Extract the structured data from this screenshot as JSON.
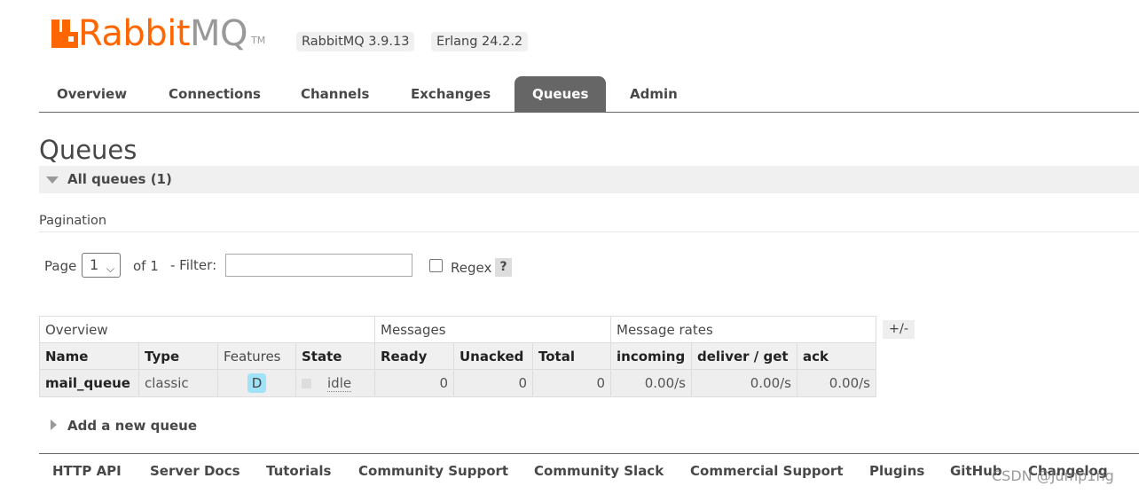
{
  "header": {
    "logo_rabbit": "Rabbit",
    "logo_mq": "MQ",
    "logo_tm": "TM",
    "rabbitmq_version": "RabbitMQ 3.9.13",
    "erlang_version": "Erlang 24.2.2"
  },
  "tabs": [
    "Overview",
    "Connections",
    "Channels",
    "Exchanges",
    "Queues",
    "Admin"
  ],
  "active_tab": "Queues",
  "page": {
    "title": "Queues",
    "section": "All queues (1)",
    "pagination_title": "Pagination",
    "page_label": "Page",
    "page_value": "1",
    "of_label": "of 1",
    "filter_label": "- Filter:",
    "filter_value": "",
    "regex_label": "Regex",
    "regex_checked": false,
    "help_label": "?"
  },
  "table": {
    "groups": [
      "Overview",
      "Messages",
      "Message rates"
    ],
    "columns": [
      "Name",
      "Type",
      "Features",
      "State",
      "Ready",
      "Unacked",
      "Total",
      "incoming",
      "deliver / get",
      "ack"
    ],
    "rows": [
      {
        "name": "mail_queue",
        "type": "classic",
        "features": "D",
        "state": "idle",
        "ready": "0",
        "unacked": "0",
        "total": "0",
        "incoming": "0.00/s",
        "deliver_get": "0.00/s",
        "ack": "0.00/s"
      }
    ],
    "column_toggle": "+/-"
  },
  "add_queue_label": "Add a new queue",
  "footer": [
    "HTTP API",
    "Server Docs",
    "Tutorials",
    "Community Support",
    "Community Slack",
    "Commercial Support",
    "Plugins",
    "GitHub",
    "Changelog"
  ],
  "watermark": "CSDN @Jump1ng",
  "colors": {
    "brand_orange": "#ff6600",
    "active_tab": "#666666",
    "feature_badge": "#a0e3f8"
  }
}
